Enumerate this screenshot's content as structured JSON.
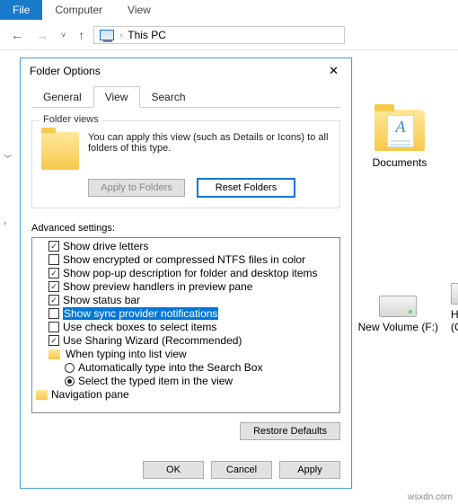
{
  "ribbon": {
    "file": "File",
    "computer": "Computer",
    "view": "View"
  },
  "nav": {
    "location": "This PC"
  },
  "items": {
    "documents": "Documents",
    "drive_f": "New Volume (F:)",
    "drive_g1": "H",
    "drive_g2": "(G"
  },
  "dialog": {
    "title": "Folder Options",
    "tabs": {
      "general": "General",
      "view": "View",
      "search": "Search"
    },
    "folder_views": {
      "label": "Folder views",
      "desc": "You can apply this view (such as Details or Icons) to all folders of this type.",
      "apply": "Apply to Folders",
      "reset": "Reset Folders"
    },
    "advanced_label": "Advanced settings:",
    "tree": {
      "drive_letters": "Show drive letters",
      "ntfs_color": "Show encrypted or compressed NTFS files in color",
      "popup_desc": "Show pop-up description for folder and desktop items",
      "preview_handlers": "Show preview handlers in preview pane",
      "status_bar": "Show status bar",
      "sync_notif": "Show sync provider notifications",
      "checkboxes": "Use check boxes to select items",
      "sharing_wizard": "Use Sharing Wizard (Recommended)",
      "typing_header": "When typing into list view",
      "typing_auto": "Automatically type into the Search Box",
      "typing_select": "Select the typed item in the view",
      "nav_pane": "Navigation pane"
    },
    "restore": "Restore Defaults",
    "ok": "OK",
    "cancel": "Cancel",
    "apply_btn": "Apply"
  },
  "watermark": "wsxdn.com"
}
